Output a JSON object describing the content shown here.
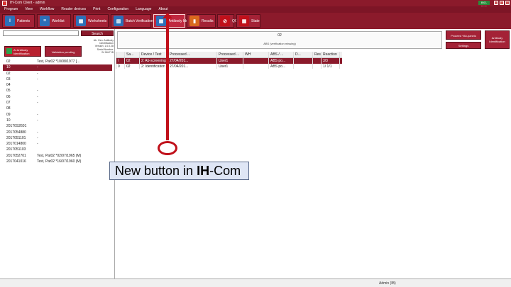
{
  "titlebar": {
    "title": "IH-Com Client - admin"
  },
  "menu": [
    "Program",
    "View",
    "Workflow",
    "Reader devices",
    "Print",
    "Configuration",
    "Language",
    "About"
  ],
  "toolbar": [
    {
      "label": "Patients",
      "icon": "info-icon",
      "glyph": "i",
      "color": "#2c6fb8"
    },
    {
      "label": "Worklist",
      "icon": "worklist-icon",
      "glyph": "≡",
      "color": "#2c6fb8"
    },
    {
      "label": "Worksheets",
      "icon": "grid-icon",
      "glyph": "▦",
      "color": "#2c6fb8"
    },
    {
      "label": "Batch Verification",
      "icon": "batch-icon",
      "glyph": "▥",
      "color": "#2c6fb8"
    },
    {
      "label": "Antibody Identification",
      "icon": "antibody-grid-icon",
      "glyph": "▦",
      "color": "#2c6fb8",
      "active": true
    },
    {
      "label": "Results",
      "icon": "tube-icon",
      "glyph": "▮",
      "color": "#d96a1e"
    },
    {
      "label": "QC",
      "icon": "stop-icon",
      "glyph": "⊘",
      "color": "#c0101a"
    },
    {
      "label": "State",
      "icon": "state-grid-icon",
      "glyph": "▦",
      "color": "#c0101a"
    }
  ],
  "left": {
    "search_placeholder": "",
    "search_label": "Search",
    "info_lines": [
      "Ab. Gen. Antibody",
      "Identification",
      "Version: 1.0.0.28",
      "Serial Number:",
      "24 0647 IB"
    ],
    "ab_ident_label": "AI Antibody Identification",
    "validation_label": "Validation pending",
    "rows": [
      {
        "id": "02",
        "text": "Test, Pat02 *10/08/1977 [..."
      },
      {
        "id": "10",
        "text": "-",
        "sel": true
      },
      {
        "id": "02",
        "text": "-"
      },
      {
        "id": "03",
        "text": "-"
      },
      {
        "id": "04",
        "text": ""
      },
      {
        "id": "05",
        "text": "-"
      },
      {
        "id": "06",
        "text": "-"
      },
      {
        "id": "07",
        "text": "-"
      },
      {
        "id": "08",
        "text": ""
      },
      {
        "id": "09",
        "text": "-"
      },
      {
        "id": "10",
        "text": "-"
      },
      {
        "id": "20170S2601",
        "text": ""
      },
      {
        "id": "2017054880",
        "text": "-"
      },
      {
        "id": "2017051101",
        "text": "-"
      },
      {
        "id": "2017014800",
        "text": "-"
      },
      {
        "id": "2017051103",
        "text": ""
      },
      {
        "id": "2017052701",
        "text": "Test, Pat02 *02/07/1965 (M)"
      },
      {
        "id": "2017041016",
        "text": "Test, Pat02 *16/07/1960 (M)"
      }
    ]
  },
  "main": {
    "sample_id": "02",
    "sample_sub": "ABS (verification missing)",
    "proceed_label": "Proceed *Ab-panels",
    "settings_label": "Settings",
    "ab_ident_label": "Antibody Identification",
    "columns": [
      "",
      "Sa...",
      "Device / Test",
      "Processed ...",
      "Processed ...",
      "WH",
      "ABS / ...",
      "D...",
      "Result rea...",
      "Reaction"
    ],
    "rows": [
      {
        "mark": "\\",
        "cells": [
          "02",
          "2: Ab-screening (U) [AB]...",
          "27/04/201...",
          "User1",
          "",
          "ABS po...",
          "",
          "",
          "3/3"
        ],
        "sel": true
      },
      {
        "mark": "0",
        "cells": [
          "02",
          "2: Identification (1) Verificat...",
          "27/04/201...",
          "User1",
          "",
          "ABS po...",
          "",
          "",
          "1/ 1/1"
        ]
      }
    ]
  },
  "status": {
    "user": "Admin (IB)"
  },
  "annotation": {
    "text_prefix": "New button in ",
    "text_bold": "IH",
    "text_suffix": "-Com"
  }
}
